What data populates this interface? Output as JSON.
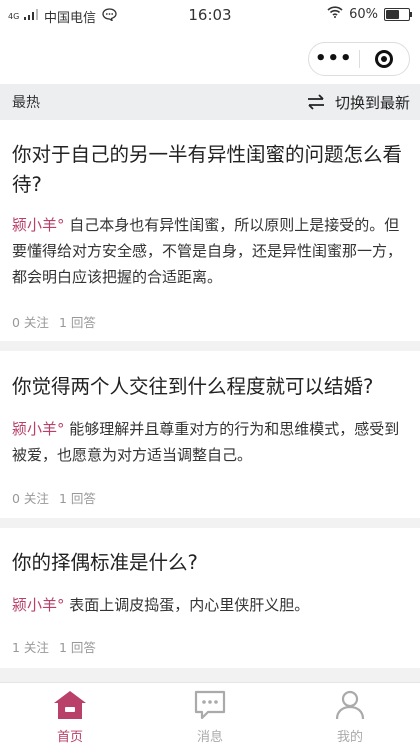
{
  "status_bar": {
    "network_type": "4G",
    "carrier": "中国电信",
    "time": "16:03",
    "battery_level": "60%",
    "battery_fraction": 0.6
  },
  "nav_bar": {
    "more_icon": "more-dots-icon",
    "close_icon": "target-circle-icon"
  },
  "filter_bar": {
    "current_sort": "最热",
    "switch_label": "切换到最新"
  },
  "questions": [
    {
      "title": "你对于自己的另一半有异性闺蜜的问题怎么看待?",
      "author": "颍小羊°",
      "answer": " 自己本身也有异性闺蜜，所以原则上是接受的。但要懂得给对方安全感，不管是自身，还是异性闺蜜那一方，都会明白应该把握的合适距离。",
      "follows": "0 关注",
      "answers": "1 回答"
    },
    {
      "title": "你觉得两个人交往到什么程度就可以结婚?",
      "author": "颍小羊°",
      "answer": " 能够理解并且尊重对方的行为和思维模式，感受到被爱，也愿意为对方适当调整自己。",
      "follows": "0 关注",
      "answers": "1 回答"
    },
    {
      "title": "你的择偶标准是什么?",
      "author": "颍小羊°",
      "answer": " 表面上调皮捣蛋，内心里侠肝义胆。",
      "follows": "1 关注",
      "answers": "1 回答"
    }
  ],
  "tab_bar": {
    "tabs": [
      {
        "label": "首页",
        "icon": "home-icon"
      },
      {
        "label": "消息",
        "icon": "message-icon"
      },
      {
        "label": "我的",
        "icon": "profile-icon"
      }
    ],
    "active_color": "#b84069",
    "inactive_color": "#aaaaaa"
  },
  "colors": {
    "accent": "#b84069"
  }
}
